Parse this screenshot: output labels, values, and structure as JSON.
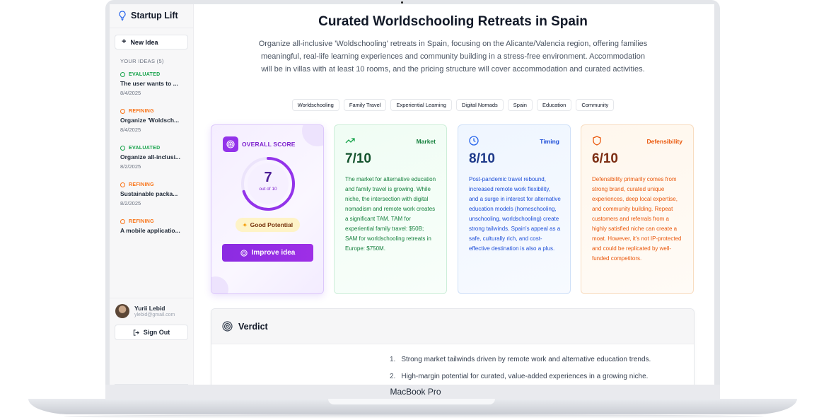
{
  "device": {
    "label": "MacBook Pro"
  },
  "sidebar": {
    "brand": "Startup Lift",
    "new_idea_label": "New Idea",
    "ideas_heading": "YOUR IDEAS (5)",
    "ideas": [
      {
        "status": "EVALUATED",
        "title": "The user wants to ...",
        "date": "8/4/2025"
      },
      {
        "status": "REFINING",
        "title": "Organize 'Woldsch...",
        "date": "8/4/2025"
      },
      {
        "status": "EVALUATED",
        "title": "Organize all-inclusi...",
        "date": "8/2/2025"
      },
      {
        "status": "REFINING",
        "title": "Sustainable packa...",
        "date": "8/2/2025"
      },
      {
        "status": "REFINING",
        "title": "A mobile applicatio...",
        "date": ""
      }
    ],
    "user": {
      "name": "Yurii Lebid",
      "email": "ylebid@gmail.com"
    },
    "sign_out_label": "Sign Out"
  },
  "main": {
    "title": "Curated Worldschooling Retreats in Spain",
    "description": "Organize all-inclusive 'Woldschooling' retreats in Spain, focusing on the Alicante/Valencia region, offering families meaningful, real-life learning experiences and community building in a stress-free environment. Accommodation will be in villas with at least 10 rooms, and the pricing structure will cover accommodation and curated activities.",
    "tags": [
      "Worldschooling",
      "Family Travel",
      "Experiential Learning",
      "Digital Nomads",
      "Spain",
      "Education",
      "Community"
    ],
    "overall": {
      "label": "OVERALL SCORE",
      "score": "7",
      "score_value": 7,
      "score_max": 10,
      "score_sub": "out of 10",
      "potential": "Good Potential",
      "improve_label": "Improve idea",
      "accent": "#9333ea"
    },
    "metrics": {
      "market": {
        "label": "Market",
        "score": "7/10",
        "text": "The market for alternative education and family travel is growing. While niche, the intersection with digital nomadism and remote work creates a significant TAM. TAM for experiential family travel: $50B; SAM for worldschooling retreats in Europe: $750M.",
        "color": "#15803d"
      },
      "timing": {
        "label": "Timing",
        "score": "8/10",
        "text": "Post-pandemic travel rebound, increased remote work flexibility, and a surge in interest for alternative education models (homeschooling, unschooling, worldschooling) create strong tailwinds. Spain's appeal as a safe, culturally rich, and cost-effective destination is also a plus.",
        "color": "#1d4ed8"
      },
      "defensibility": {
        "label": "Defensibility",
        "score": "6/10",
        "text": "Defensibility primarily comes from strong brand, curated unique experiences, deep local expertise, and community building. Repeat customers and referrals from a highly satisfied niche can create a moat. However, it's not IP-protected and could be replicated by well-funded competitors.",
        "color": "#ea580c"
      }
    },
    "verdict": {
      "title": "Verdict",
      "items": [
        {
          "num": "1.",
          "text": "Strong market tailwinds driven by remote work and alternative education trends."
        },
        {
          "num": "2.",
          "text": "High-margin potential for curated, value-added experiences in a growing niche."
        }
      ]
    }
  },
  "colors": {
    "evaluated": "#16a34a",
    "refining": "#f97316",
    "purple": "#9333ea"
  },
  "icons": {
    "brand": "lightbulb-icon",
    "market": "trending-up-icon",
    "timing": "clock-icon",
    "defensibility": "shield-icon",
    "overall": "target-icon",
    "verdict": "target-icon"
  }
}
